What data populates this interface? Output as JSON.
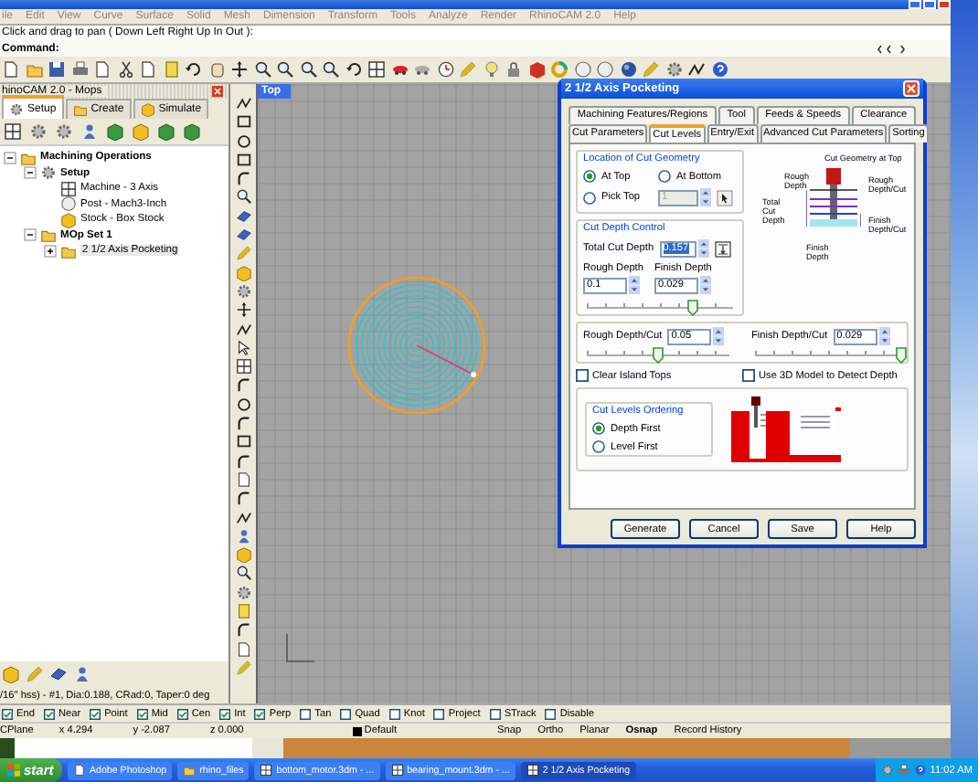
{
  "menu": [
    "ile",
    "Edit",
    "View",
    "Curve",
    "Surface",
    "Solid",
    "Mesh",
    "Dimension",
    "Transform",
    "Tools",
    "Analyze",
    "Render",
    "RhinoCAM 2.0",
    "Help"
  ],
  "prompt": "Click and drag to pan ( Down Left Right Up In Out ):",
  "command": "Command:",
  "panel": {
    "title": "hinoCAM 2.0 - Mops",
    "tabs": [
      {
        "label": "Setup",
        "selected": true
      },
      {
        "label": "Create",
        "selected": false
      },
      {
        "label": "Simulate",
        "selected": false
      }
    ],
    "tree": [
      {
        "label": "Machining Operations",
        "kind": "folder",
        "expanded": true,
        "selected": false,
        "children": [
          {
            "label": "Setup",
            "kind": "setup",
            "expanded": true,
            "selected": false,
            "children": [
              {
                "label": "Machine - 3 Axis",
                "kind": "machine",
                "selected": false
              },
              {
                "label": "Post - Mach3-Inch",
                "kind": "post",
                "selected": false
              },
              {
                "label": "Stock - Box Stock",
                "kind": "stock",
                "selected": false
              }
            ]
          },
          {
            "label": "MOp Set 1",
            "kind": "folder",
            "expanded": true,
            "selected": false,
            "children": [
              {
                "label": "2 1/2 Axis Pocketing",
                "kind": "operation",
                "expanded": false,
                "selected": true
              }
            ]
          }
        ]
      }
    ],
    "tool_info": "/16\" hss) - #1, Dia:0.188, CRad:0, Taper:0 deg"
  },
  "viewport": {
    "label": "Top"
  },
  "dialog": {
    "title": "2 1/2 Axis Pocketing",
    "tab_rows": [
      [
        {
          "label": "Machining Features/Regions",
          "selected": false
        },
        {
          "label": "Tool",
          "selected": false
        },
        {
          "label": "Feeds & Speeds",
          "selected": false
        },
        {
          "label": "Clearance",
          "selected": false
        }
      ],
      [
        {
          "label": "Cut Parameters",
          "selected": false
        },
        {
          "label": "Cut Levels",
          "selected": true
        },
        {
          "label": "Entry/Exit",
          "selected": false
        },
        {
          "label": "Advanced Cut Parameters",
          "selected": false
        },
        {
          "label": "Sorting",
          "selected": false
        }
      ]
    ],
    "location": {
      "title": "Location of Cut Geometry",
      "options": [
        {
          "label": "At Top",
          "selected": true
        },
        {
          "label": "At Bottom",
          "selected": false
        },
        {
          "label": "Pick Top",
          "selected": false
        }
      ],
      "pick_value": "1",
      "pick_disabled": true
    },
    "depth_control": {
      "title": "Cut Depth Control",
      "total_label": "Total Cut Depth",
      "total_value": "0.157",
      "total_highlighted": true,
      "rough_label": "Rough Depth",
      "rough_value": "0.1",
      "finish_label": "Finish Depth",
      "finish_value": "0.029",
      "level": 0.72
    },
    "per_cut": [
      {
        "label": "Rough Depth/Cut",
        "value": "0.05",
        "level": 0.5
      },
      {
        "label": "Finish Depth/Cut",
        "value": "0.029",
        "level": 1
      }
    ],
    "checks": [
      {
        "label": "Clear Island Tops",
        "checked": false
      },
      {
        "label": "Use 3D Model to Detect Depth",
        "checked": false
      }
    ],
    "ordering": {
      "title": "Cut Levels Ordering",
      "options": [
        {
          "label": "Depth First",
          "selected": true
        },
        {
          "label": "Level First",
          "selected": false
        }
      ]
    },
    "diagram_labels": [
      "Cut Geometry at Top",
      "Rough Depth",
      "Rough Depth/Cut",
      "Total Cut Depth",
      "Finish Depth/Cut",
      "Finish Depth"
    ],
    "buttons": [
      "Generate",
      "Cancel",
      "Save",
      "Help"
    ]
  },
  "osnaps": [
    {
      "label": "End",
      "checked": true
    },
    {
      "label": "Near",
      "checked": true
    },
    {
      "label": "Point",
      "checked": true
    },
    {
      "label": "Mid",
      "checked": true
    },
    {
      "label": "Cen",
      "checked": true
    },
    {
      "label": "Int",
      "checked": true
    },
    {
      "label": "Perp",
      "checked": true
    },
    {
      "label": "Tan",
      "checked": false
    },
    {
      "label": "Quad",
      "checked": false
    },
    {
      "label": "Knot",
      "checked": false
    },
    {
      "label": "Project",
      "checked": false
    },
    {
      "label": "STrack",
      "checked": false
    },
    {
      "label": "Disable",
      "checked": false
    }
  ],
  "status": {
    "cplane": "CPlane",
    "x": "x 4.294",
    "y": "y -2.087",
    "z": "z 0.000",
    "layer": "Default",
    "toggles": [
      {
        "label": "Snap",
        "on": false
      },
      {
        "label": "Ortho",
        "on": false
      },
      {
        "label": "Planar",
        "on": false
      },
      {
        "label": "Osnap",
        "on": true
      },
      {
        "label": "Record History",
        "on": false
      }
    ]
  },
  "taskbar": {
    "start": "start",
    "tasks": [
      {
        "label": "Adobe Photoshop",
        "kind": "photoshop",
        "selected": false
      },
      {
        "label": "rhino_files",
        "kind": "folder",
        "selected": false
      },
      {
        "label": "bottom_motor.3dm - ...",
        "kind": "rhino",
        "selected": false
      },
      {
        "label": "bearing_mount.3dm - ...",
        "kind": "rhino",
        "selected": false
      },
      {
        "label": "2 1/2 Axis Pocketing",
        "kind": "rhino",
        "selected": true
      }
    ],
    "clock": "11:02 AM"
  }
}
